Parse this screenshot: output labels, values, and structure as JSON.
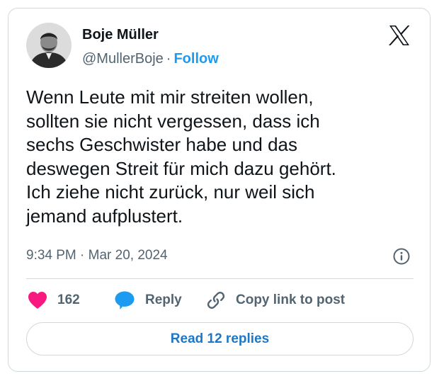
{
  "author": {
    "name": "Boje Müller",
    "handle": "@MullerBoje",
    "separator": "·",
    "follow_label": "Follow"
  },
  "icons": {
    "platform": "x-logo-icon",
    "info": "info-icon",
    "like": "heart-icon",
    "reply": "speech-bubble-icon",
    "copy_link": "link-icon"
  },
  "tweet": {
    "text": "Wenn Leute mit mir streiten wollen,\nsollten sie nicht vergessen, dass ich\nsechs Geschwister habe und das\ndeswegen Streit für mich dazu gehört.\nIch ziehe nicht zurück, nur weil sich\njemand aufplustert.",
    "time": "9:34 PM",
    "date": "Mar 20, 2024",
    "meta_separator": "·"
  },
  "actions": {
    "like_count": "162",
    "reply_label": "Reply",
    "copy_label": "Copy link to post"
  },
  "read_replies_label": "Read 12 replies",
  "colors": {
    "accent": "#1d9bf0",
    "heart": "#f91880",
    "reply_bubble": "#1d9bf0",
    "muted": "#536471",
    "border": "#cfd9de"
  }
}
